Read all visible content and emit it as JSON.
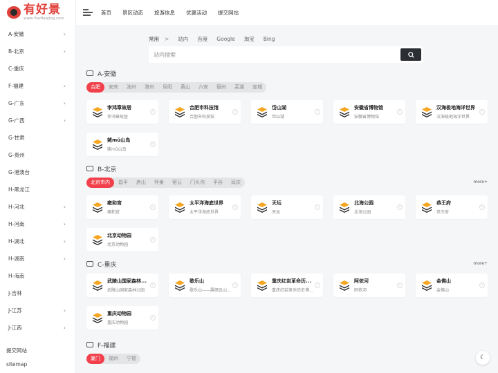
{
  "logo": {
    "title": "有好景",
    "subtitle": "www.YouHaoJing.com"
  },
  "header": {
    "nav": [
      "首页",
      "景区动态",
      "旅游信息",
      "优惠活动",
      "提交网站"
    ]
  },
  "sidebar": {
    "items": [
      {
        "label": "A-安徽",
        "arrow": true
      },
      {
        "label": "B-北京",
        "arrow": true
      },
      {
        "label": "C-重庆",
        "arrow": false
      },
      {
        "label": "F-福建",
        "arrow": true
      },
      {
        "label": "G-广东",
        "arrow": true
      },
      {
        "label": "G-广西",
        "arrow": true
      },
      {
        "label": "G-甘肃",
        "arrow": false
      },
      {
        "label": "G-贵州",
        "arrow": false
      },
      {
        "label": "G-港澳台",
        "arrow": false
      },
      {
        "label": "H-黑龙江",
        "arrow": false
      },
      {
        "label": "H-河北",
        "arrow": true
      },
      {
        "label": "H-河南",
        "arrow": true
      },
      {
        "label": "H-湖北",
        "arrow": true
      },
      {
        "label": "H-湖南",
        "arrow": true
      },
      {
        "label": "H-海南",
        "arrow": false
      },
      {
        "label": "J-吉林",
        "arrow": false
      },
      {
        "label": "J-江苏",
        "arrow": true
      },
      {
        "label": "J-江西",
        "arrow": true
      }
    ],
    "bottom": [
      "提交网站",
      "sitemap"
    ],
    "arrow_glyph": "›"
  },
  "search": {
    "group": "常用",
    "group_arrow": ">",
    "engines": [
      "站内",
      "百度",
      "Google",
      "淘宝",
      "Bing"
    ],
    "placeholder": "站内搜索"
  },
  "colors": {
    "accent": "#f1404b",
    "dark": "#2b2f33"
  },
  "sections": [
    {
      "title": "A-安徽",
      "chips": [
        "合肥",
        "安庆",
        "池州",
        "滁州",
        "阜阳",
        "黄山",
        "六安",
        "宿州",
        "芜湖",
        "宣城"
      ],
      "active": 0,
      "more": "",
      "cards": [
        {
          "title": "李鸿章故居",
          "desc": "李鸿章故居"
        },
        {
          "title": "合肥市科技馆",
          "desc": "合肥市科技馆"
        },
        {
          "title": "岱山湖",
          "desc": "岱山湖"
        },
        {
          "title": "安徽省博物馆",
          "desc": "安徽省博物馆"
        },
        {
          "title": "汉海极地海洋世界",
          "desc": "汉海极地海洋世界"
        },
        {
          "title": "姥mǔ山岛",
          "desc": "姥mǔ山岛"
        }
      ]
    },
    {
      "title": "B-北京",
      "chips": [
        "北京市内",
        "昌平",
        "房山",
        "怀柔",
        "密云",
        "门头沟",
        "平谷",
        "延庆"
      ],
      "active": 0,
      "more": "more+",
      "cards": [
        {
          "title": "雍和宫",
          "desc": "雍和宫"
        },
        {
          "title": "太平洋海底世界",
          "desc": "太平洋海底世界"
        },
        {
          "title": "天坛",
          "desc": "天坛"
        },
        {
          "title": "北海公园",
          "desc": "北海公园"
        },
        {
          "title": "恭王府",
          "desc": "恭王府"
        },
        {
          "title": "北京动物园",
          "desc": "北京动物园"
        }
      ]
    },
    {
      "title": "C-重庆",
      "chips": [],
      "active": -1,
      "more": "more+",
      "cards": [
        {
          "title": "武陵山国家森林...",
          "desc": "武陵山国家森林公园"
        },
        {
          "title": "歌乐山",
          "desc": "歌乐山——属缙云山..."
        },
        {
          "title": "重庆红岩革命历...",
          "desc": "重庆红岩革命历史博..."
        },
        {
          "title": "阿依河",
          "desc": "阿依河"
        },
        {
          "title": "金佛山",
          "desc": "金佛山"
        },
        {
          "title": "重庆动物园",
          "desc": "重庆动物园"
        }
      ]
    },
    {
      "title": "F-福建",
      "chips": [
        "厦门",
        "福州",
        "宁德"
      ],
      "active": 0,
      "more": "",
      "cards": []
    }
  ]
}
